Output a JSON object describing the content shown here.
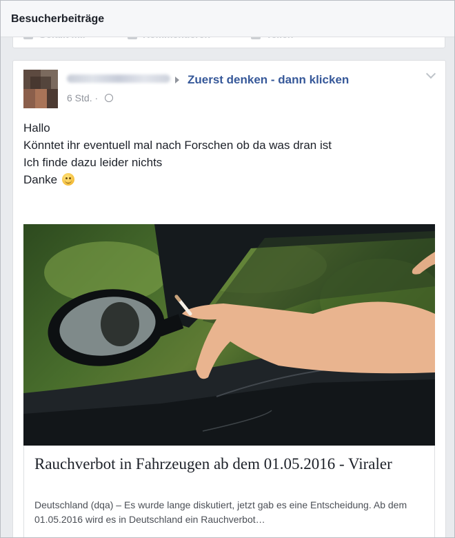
{
  "header": {
    "title": "Besucherbeiträge"
  },
  "previous_post": {
    "actions": [
      {
        "label": "Gefällt mir",
        "icon": "like-icon"
      },
      {
        "label": "Kommentieren",
        "icon": "comment-icon"
      },
      {
        "label": "Teilen",
        "icon": "share-icon"
      }
    ]
  },
  "post": {
    "group_name": "Zuerst denken - dann klicken",
    "time": "6 Std. ·",
    "text_lines": [
      "Hallo",
      "Könntet ihr eventuell mal nach Forschen ob da was dran ist",
      "Ich finde dazu leider nichts",
      "Danke"
    ],
    "link": {
      "title": "Rauchverbot in Fahrzeugen ab dem 01.05.2016 - Viraler",
      "description": "Deutschland (dqa) – Es wurde lange diskutiert, jetzt gab es eine Entscheidung. Ab dem 01.05.2016 wird es in Deutschland ein Rauchverbot…"
    }
  }
}
